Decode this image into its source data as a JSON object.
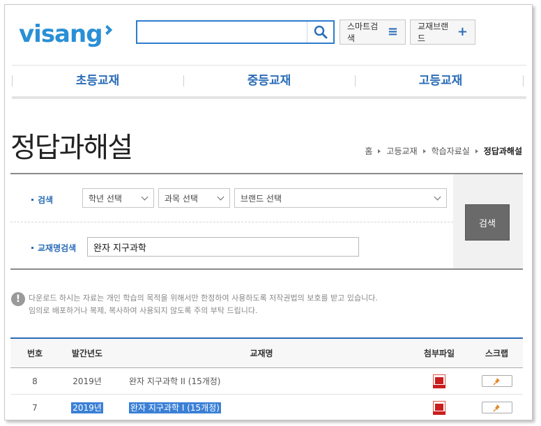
{
  "header": {
    "logo_text": "visang",
    "search_placeholder": "",
    "smart_search_label": "스마트검색",
    "brand_label": "교재브랜드",
    "brand_color": "#2a8fd6"
  },
  "nav": {
    "items": [
      {
        "label": "초등교재"
      },
      {
        "label": "중등교재"
      },
      {
        "label": "고등교재"
      }
    ]
  },
  "page": {
    "title": "정답과해설",
    "breadcrumb": [
      "홈",
      "고등교재",
      "학습자료실",
      "정답과해설"
    ]
  },
  "search_form": {
    "search_label": "검색",
    "grade_select": "학년 선택",
    "subject_select": "과목 선택",
    "brand_select": "브랜드 선택",
    "book_name_label": "교재명검색",
    "book_name_value": "완자 지구과학",
    "submit_label": "검색"
  },
  "notice": {
    "line1": "다운로드 하시는 자료는 개인 학습의 목적을 위해서만 한정하여 사용하도록 저작권법의 보호를 받고 있습니다.",
    "line2": "임의로 배포하거나 복제, 복사하여 사용되지 않도록 주의 부탁 드립니다."
  },
  "table": {
    "headers": {
      "no": "번호",
      "year": "발간년도",
      "name": "교재명",
      "file": "첨부파일",
      "scrap": "스크랩"
    },
    "rows": [
      {
        "no": "8",
        "year": "2019년",
        "name": "완자 지구과학 II (15개정)",
        "selected": false
      },
      {
        "no": "7",
        "year": "2019년",
        "name": "완자 지구과학 I (15개정)",
        "selected": true
      }
    ]
  }
}
